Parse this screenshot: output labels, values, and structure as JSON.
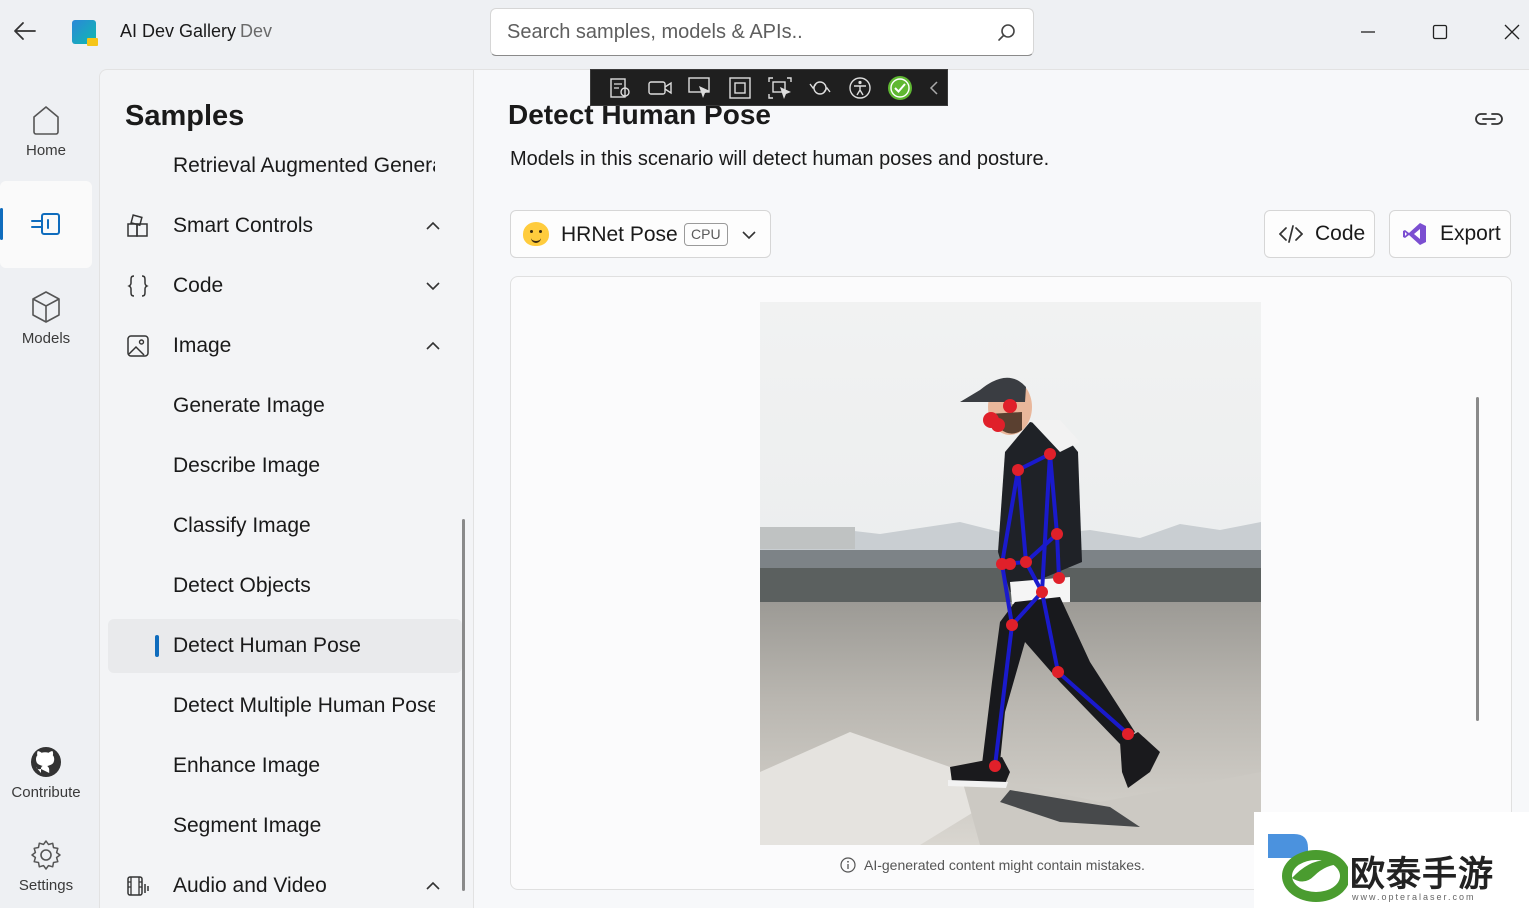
{
  "window": {
    "app_title": "AI Dev Gallery",
    "app_badge": "Dev",
    "back_icon": "arrow-left-icon",
    "minimize_icon": "minimize-icon",
    "maximize_icon": "maximize-icon",
    "close_icon": "close-icon"
  },
  "search": {
    "placeholder": "Search samples, models & APIs..",
    "icon": "search-icon"
  },
  "rail": {
    "items": [
      {
        "label": "Home",
        "icon": "home-icon"
      },
      {
        "label": "",
        "icon": "samples-icon",
        "selected": true
      },
      {
        "label": "Models",
        "icon": "cube-icon"
      },
      {
        "label": "Contribute",
        "icon": "github-icon"
      },
      {
        "label": "Settings",
        "icon": "gear-icon"
      }
    ]
  },
  "samples": {
    "title": "Samples",
    "items": [
      {
        "label": "Retrieval Augmented Generation",
        "type": "sub"
      },
      {
        "label": "Smart Controls",
        "type": "group",
        "icon": "smart-controls-icon",
        "expanded": true
      },
      {
        "label": "Code",
        "type": "group",
        "icon": "braces-icon",
        "expanded": false
      },
      {
        "label": "Image",
        "type": "group",
        "icon": "image-icon",
        "expanded": true
      },
      {
        "label": "Generate Image",
        "type": "sub"
      },
      {
        "label": "Describe Image",
        "type": "sub"
      },
      {
        "label": "Classify Image",
        "type": "sub"
      },
      {
        "label": "Detect Objects",
        "type": "sub"
      },
      {
        "label": "Detect Human Pose",
        "type": "sub",
        "selected": true
      },
      {
        "label": "Detect Multiple Human Poses",
        "type": "sub"
      },
      {
        "label": "Enhance Image",
        "type": "sub"
      },
      {
        "label": "Segment Image",
        "type": "sub"
      },
      {
        "label": "Audio and Video",
        "type": "group",
        "icon": "audio-video-icon",
        "expanded": true
      }
    ]
  },
  "page": {
    "title": "Detect Human Pose",
    "description": "Models in this scenario will detect human poses and posture.",
    "link_icon": "link-icon"
  },
  "model_selector": {
    "name": "HRNet Pose",
    "badge": "CPU",
    "icon": "hugging-face-icon"
  },
  "actions": {
    "code_label": "Code",
    "export_label": "Export"
  },
  "result": {
    "disclaimer": "AI-generated content might contain mistakes.",
    "image_alt": "Person walking with detected pose skeleton overlay"
  },
  "watermark": {
    "text": "欧泰手游网",
    "url": "www.opteralaser.com"
  },
  "colors": {
    "accent": "#0f6cbd",
    "skeleton": "#1a1acc",
    "keypoint": "#e0202a"
  }
}
